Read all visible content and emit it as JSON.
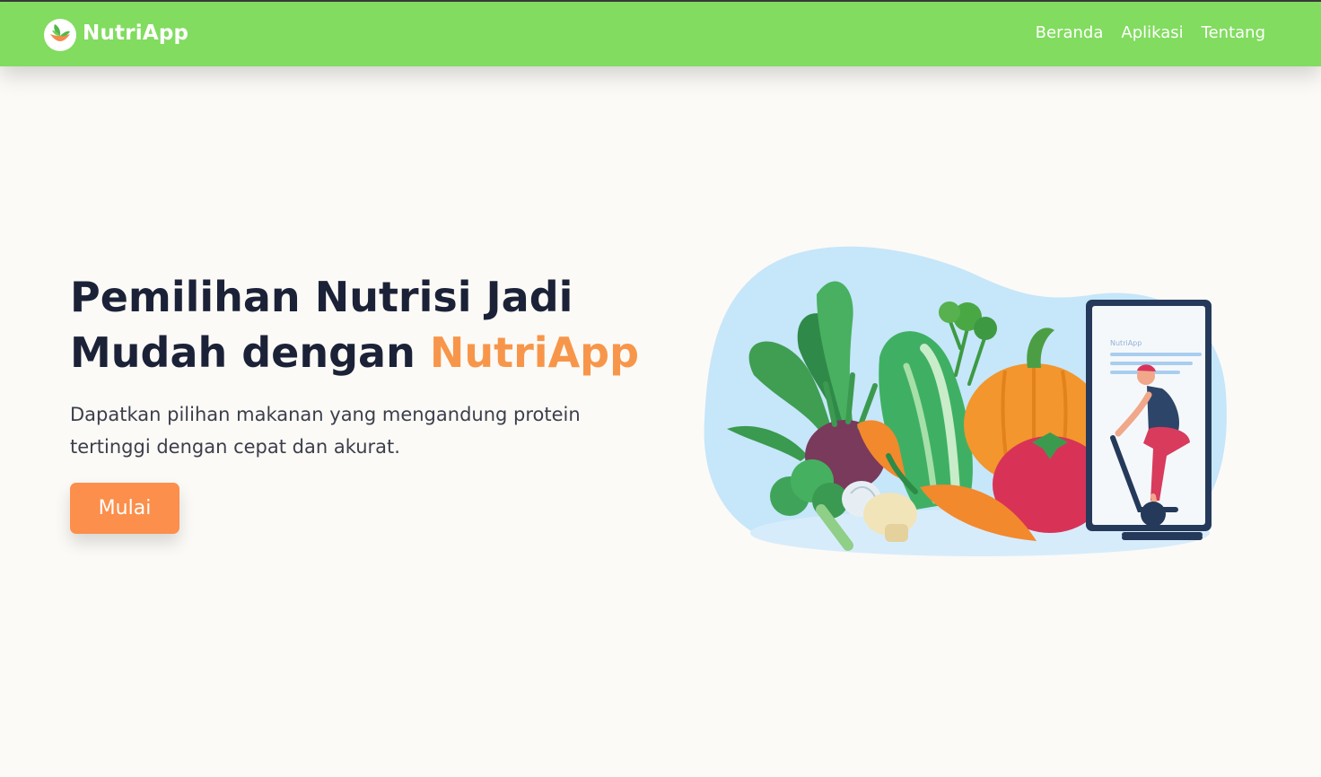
{
  "nav": {
    "brand": "NutriApp",
    "links": [
      "Beranda",
      "Aplikasi",
      "Tentang"
    ]
  },
  "hero": {
    "title_part1": "Pemilihan Nutrisi Jadi Mudah dengan ",
    "title_accent": "NutriApp",
    "subtitle": "Dapatkan pilihan makanan yang mengandung protein tertinggi dengan cepat dan akurat.",
    "cta_label": "Mulai"
  },
  "illustration": {
    "phone_app_label": "NutriApp"
  },
  "colors": {
    "navbar_bg": "#81dc5f",
    "page_bg": "#fcfaf6",
    "heading": "#1b2238",
    "accent": "#f7964a",
    "button_bg": "#fb8f4b"
  }
}
